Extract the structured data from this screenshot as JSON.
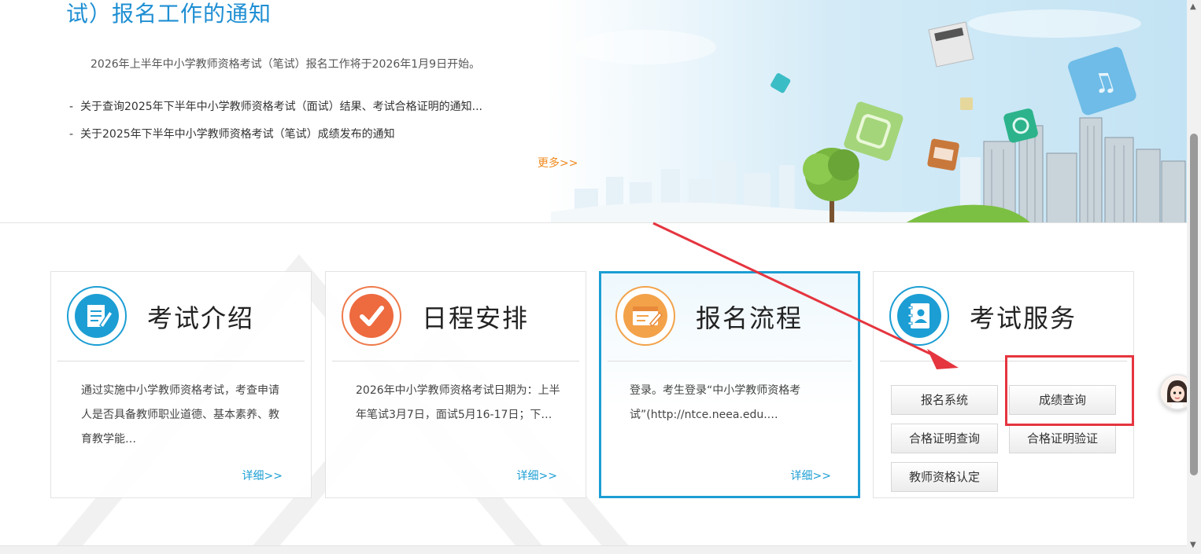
{
  "banner": {
    "title": "试）报名工作的通知",
    "lead": "2026年上半年中小学教师资格考试（笔试）报名工作将于2026年1月9日开始。",
    "news": [
      "关于查询2025年下半年中小学教师资格考试（面试）结果、考试合格证明的通知...",
      "关于2025年下半年中小学教师资格考试（笔试）成绩发布的通知"
    ],
    "bullet": "-",
    "more": "更多>>"
  },
  "cards": [
    {
      "title": "考试介绍",
      "icon": "document-edit-icon",
      "desc": "通过实施中小学教师资格考试，考查申请人是否具备教师职业道德、基本素养、教育教学能…",
      "detail": "详细>>"
    },
    {
      "title": "日程安排",
      "icon": "checkmark-icon",
      "desc": "2026年中小学教师资格考试日期为：上半年笔试3月7日，面试5月16-17日；下…",
      "detail": "详细>>"
    },
    {
      "title": "报名流程",
      "icon": "registration-form-icon",
      "desc": "登录。考生登录“中小学教师资格考试”(http://ntce.neea.edu.…",
      "detail": "详细>>"
    },
    {
      "title": "考试服务",
      "icon": "contact-book-icon",
      "buttons": [
        "报名系统",
        "成绩查询",
        "合格证明查询",
        "合格证明验证",
        "教师资格认定"
      ]
    }
  ],
  "colors": {
    "accent": "#1c9ed4",
    "title_blue": "#1f8fd3",
    "more_orange": "#f08a1c",
    "highlight_red": "#e5353f"
  },
  "annotation": {
    "arrow_icon": "red-arrow-icon",
    "highlighted": "成绩查询"
  },
  "assistant_icon": "assistant-avatar-icon"
}
